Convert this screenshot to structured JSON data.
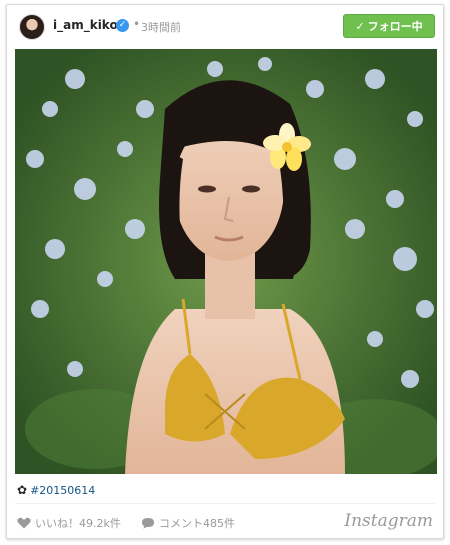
{
  "header": {
    "username": "i_am_kiko",
    "verified_icon": "verified-badge-icon",
    "separator": "•",
    "timestamp": "3時間前",
    "follow_label": "フォロー中",
    "follow_icon": "checkmark-icon"
  },
  "photo": {
    "subject": "portrait photo"
  },
  "caption": {
    "icon": "flower-icon",
    "hashtag": "#20150614"
  },
  "footer": {
    "likes": "いいね！49.2k件",
    "comments": "コメント485件",
    "brand": "Instagram"
  },
  "colors": {
    "follow_button": "#70c050",
    "verified": "#3897f0",
    "hashtag": "#125688",
    "muted_text": "#999999"
  }
}
